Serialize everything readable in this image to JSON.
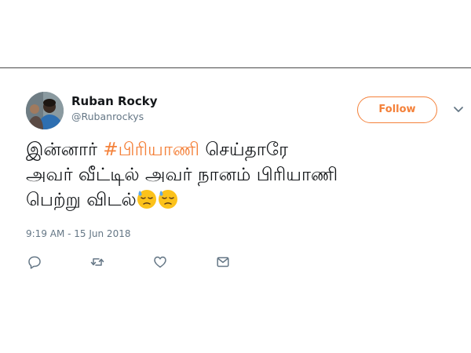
{
  "tweet": {
    "author_name": "Ruban Rocky",
    "author_handle": "@Rubanrockys",
    "follow_label": "Follow",
    "text_line1_pre": "இன்னார் ",
    "hashtag": "#பிரியாணி",
    "text_line1_post": " செய்தாரே",
    "text_line2": "அவர் வீட்டில் அவர் நானம் பிரியாணி",
    "text_line3": "பெற்று விடல்",
    "emojis": [
      "downcast-face-with-sweat",
      "downcast-face-with-sweat"
    ],
    "timestamp": "9:19 AM - 15 Jun 2018"
  },
  "actions": [
    {
      "icon": "reply-icon"
    },
    {
      "icon": "retweet-icon"
    },
    {
      "icon": "like-icon"
    },
    {
      "icon": "direct-message-icon"
    }
  ],
  "colors": {
    "accent": "#f4813a",
    "text": "#14171a",
    "muted": "#657786"
  }
}
